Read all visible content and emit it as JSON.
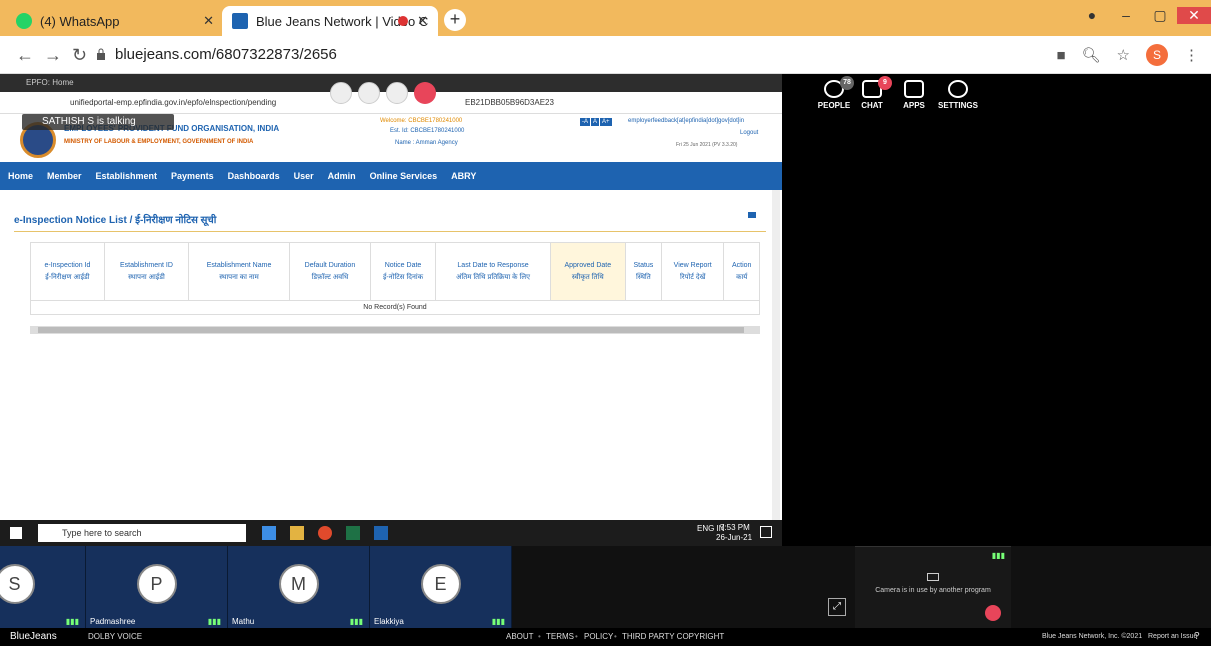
{
  "browser": {
    "tabs": [
      {
        "label": "(4) WhatsApp",
        "color": "#25d366"
      },
      {
        "label": "Blue Jeans Network | Video C",
        "color": "#1e63b0"
      }
    ],
    "new_tab": "+",
    "url": "bluejeans.com/6807322873/2656",
    "profile": "S"
  },
  "share": {
    "inner_tab": "EPFO: Home",
    "inner_url": "unifiedportal-emp.epfindia.gov.in/epfo/elnspection/pending",
    "inner_url_tail": "EB21DBB05B96D3AE23",
    "talking": "SATHISH S is talking",
    "org_title": "EMPLOYEES' PROVIDENT FUND ORGANISATION, INDIA",
    "org_sub": "MINISTRY OF LABOUR & EMPLOYMENT, GOVERNMENT OF INDIA",
    "welcome": "Welcome: CBCBE1780241000",
    "est_id": "Est. Id: CBCBE1780241000",
    "name": "Name : Amman Agency",
    "feedback": "employerfeedback[at]epfindia[dot]gov[dot]in",
    "logout": "Logout",
    "date": "Fri 25 Jun 2021 (PV 3.3.20)",
    "font_btns": [
      "-A",
      "A",
      "A+"
    ],
    "menu": [
      "Home",
      "Member",
      "Establishment",
      "Payments",
      "Dashboards",
      "User",
      "Admin",
      "Online Services",
      "ABRY"
    ],
    "page_title": "e-Inspection Notice List / ई-निरीक्षण नोटिस सूची",
    "columns": [
      [
        "e-Inspection Id",
        "ई-निरीक्षण आईडी"
      ],
      [
        "Establishment ID",
        "स्थापना आईडी"
      ],
      [
        "Establishment Name",
        "स्थापना का नाम"
      ],
      [
        "Default Duration",
        "डिफ़ॉल्ट अवधि"
      ],
      [
        "Notice Date",
        "ई-नोटिस दिनांक"
      ],
      [
        "Last Date to Response",
        "अंतिम तिथि प्रतिक्रिया के लिए"
      ],
      [
        "Approved Date",
        "स्वीकृत तिथि"
      ],
      [
        "Status",
        "स्थिति"
      ],
      [
        "View Report",
        "रिपोर्ट देखें"
      ],
      [
        "Action",
        "कार्य"
      ]
    ],
    "empty_row": "No Record(s) Found",
    "taskbar_search": "Type here to search",
    "tray_lang": "ENG IN",
    "tray_time": "7:53 PM",
    "tray_date": "26-Jun-21"
  },
  "panel": {
    "people_count": "78",
    "people": "PEOPLE",
    "chat_count": "9",
    "chat": "CHAT",
    "apps": "APPS",
    "settings": "SETTINGS"
  },
  "participants": [
    {
      "initial": "S",
      "name": ""
    },
    {
      "initial": "P",
      "name": "Padmashree"
    },
    {
      "initial": "M",
      "name": "Mathu"
    },
    {
      "initial": "E",
      "name": "Elakkiya"
    }
  ],
  "camera_msg": "Camera is in use by another program",
  "footer": {
    "brand": "BlueJeans",
    "dolby": "DOLBY VOICE",
    "links": [
      "ABOUT",
      "TERMS",
      "POLICY",
      "THIRD PARTY COPYRIGHT"
    ],
    "copyright": "Blue Jeans Network, Inc. ©2021",
    "report": "Report an Issue"
  }
}
